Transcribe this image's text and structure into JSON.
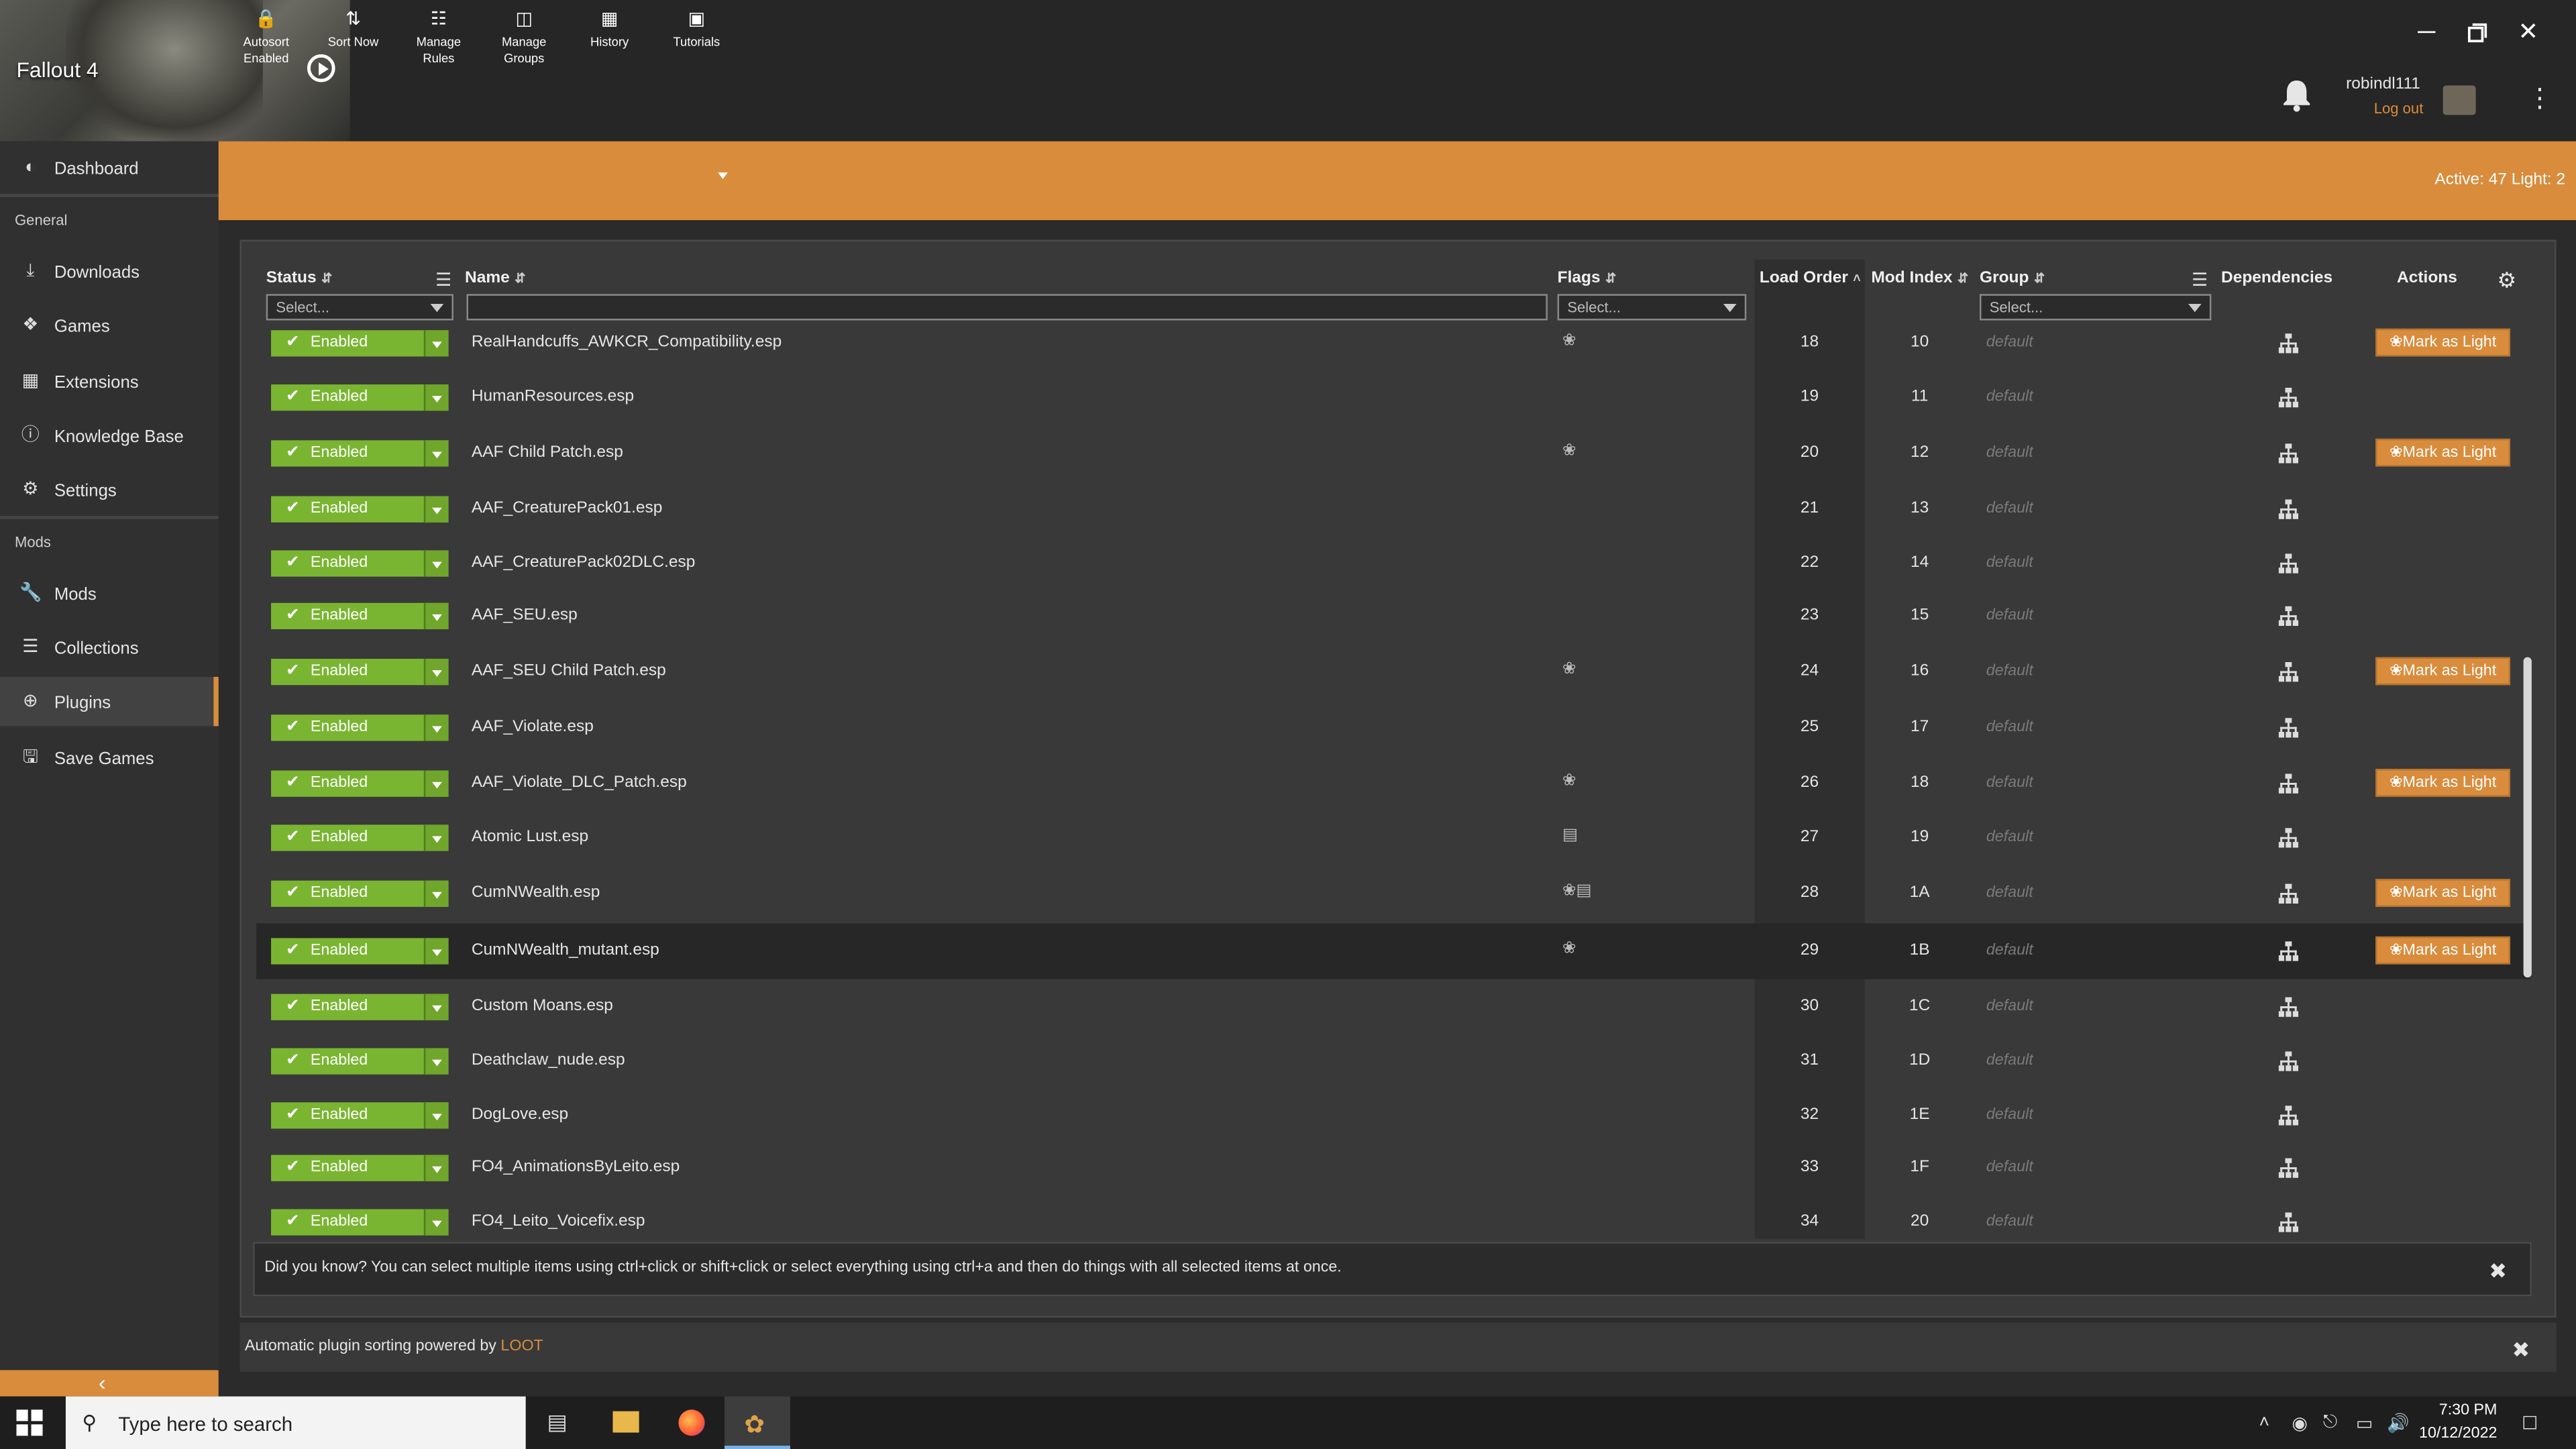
{
  "header": {
    "game_title": "Fallout 4",
    "username": "robindl111",
    "logout_label": "Log out"
  },
  "sidebar": {
    "dashboard": "Dashboard",
    "section_general": "General",
    "general_items": [
      {
        "label": "Downloads",
        "icon": "download-icon"
      },
      {
        "label": "Games",
        "icon": "gamepad-icon"
      },
      {
        "label": "Extensions",
        "icon": "extensions-icon"
      },
      {
        "label": "Knowledge Base",
        "icon": "info-icon"
      },
      {
        "label": "Settings",
        "icon": "gear-icon"
      }
    ],
    "section_mods": "Mods",
    "mods_items": [
      {
        "label": "Mods",
        "icon": "wrench-icon"
      },
      {
        "label": "Collections",
        "icon": "layers-icon"
      },
      {
        "label": "Plugins",
        "icon": "plus-circle-icon",
        "active": true
      },
      {
        "label": "Save Games",
        "icon": "save-icon"
      }
    ]
  },
  "toolbar": {
    "autosort_line1": "Autosort",
    "autosort_line2": "Enabled",
    "sortnow": "Sort Now",
    "managerules_line1": "Manage",
    "managerules_line2": "Rules",
    "managegroups_line1": "Manage",
    "managegroups_line2": "Groups",
    "history": "History",
    "tutorials": "Tutorials",
    "active_count": "Active: 47 Light: 2"
  },
  "table": {
    "headers": {
      "status": "Status",
      "name": "Name",
      "flags": "Flags",
      "load_order": "Load Order",
      "mod_index": "Mod Index",
      "group": "Group",
      "dependencies": "Dependencies",
      "actions": "Actions"
    },
    "filter_placeholder": "Select...",
    "status_label": "Enabled",
    "mark_light_label": "Mark as Light",
    "rows": [
      {
        "name": "RealHandcuffs_AWKCR_Compatibility.esp",
        "lo": "18",
        "mi": "10",
        "group": "default",
        "flag": "light",
        "mark": true
      },
      {
        "name": "HumanResources.esp",
        "lo": "19",
        "mi": "11",
        "group": "default",
        "flag": "",
        "mark": false
      },
      {
        "name": "AAF Child Patch.esp",
        "lo": "20",
        "mi": "12",
        "group": "default",
        "flag": "light",
        "mark": true
      },
      {
        "name": "AAF_CreaturePack01.esp",
        "lo": "21",
        "mi": "13",
        "group": "default",
        "flag": "",
        "mark": false
      },
      {
        "name": "AAF_CreaturePack02DLC.esp",
        "lo": "22",
        "mi": "14",
        "group": "default",
        "flag": "",
        "mark": false
      },
      {
        "name": "AAF_SEU.esp",
        "lo": "23",
        "mi": "15",
        "group": "default",
        "flag": "",
        "mark": false
      },
      {
        "name": "AAF_SEU Child Patch.esp",
        "lo": "24",
        "mi": "16",
        "group": "default",
        "flag": "light",
        "mark": true
      },
      {
        "name": "AAF_Violate.esp",
        "lo": "25",
        "mi": "17",
        "group": "default",
        "flag": "",
        "mark": false
      },
      {
        "name": "AAF_Violate_DLC_Patch.esp",
        "lo": "26",
        "mi": "18",
        "group": "default",
        "flag": "light",
        "mark": true
      },
      {
        "name": "Atomic Lust.esp",
        "lo": "27",
        "mi": "19",
        "group": "default",
        "flag": "archive",
        "mark": false
      },
      {
        "name": "CumNWealth.esp",
        "lo": "28",
        "mi": "1A",
        "group": "default",
        "flag": "light-archive",
        "mark": true
      },
      {
        "name": "CumNWealth_mutant.esp",
        "lo": "29",
        "mi": "1B",
        "group": "default",
        "flag": "light",
        "mark": true,
        "selected": true
      },
      {
        "name": "Custom Moans.esp",
        "lo": "30",
        "mi": "1C",
        "group": "default",
        "flag": "",
        "mark": false
      },
      {
        "name": "Deathclaw_nude.esp",
        "lo": "31",
        "mi": "1D",
        "group": "default",
        "flag": "",
        "mark": false
      },
      {
        "name": "DogLove.esp",
        "lo": "32",
        "mi": "1E",
        "group": "default",
        "flag": "",
        "mark": false
      },
      {
        "name": "FO4_AnimationsByLeito.esp",
        "lo": "33",
        "mi": "1F",
        "group": "default",
        "flag": "",
        "mark": false
      },
      {
        "name": "FO4_Leito_Voicefix.esp",
        "lo": "34",
        "mi": "20",
        "group": "default",
        "flag": "",
        "mark": false
      }
    ]
  },
  "tip": {
    "text": "Did you know? You can select multiple items using ctrl+click or shift+click or select everything using ctrl+a and then do things with all selected items at once."
  },
  "loot": {
    "prefix": "Automatic plugin sorting powered by ",
    "link": "LOOT"
  },
  "taskbar": {
    "search_placeholder": "Type here to search",
    "time": "7:30 PM",
    "date": "10/12/2022"
  },
  "colors": {
    "accent": "#d98c3c",
    "enabled_green": "#7ab532"
  }
}
